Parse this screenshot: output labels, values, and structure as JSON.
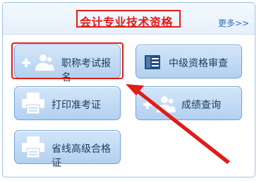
{
  "header": {
    "title": "会计专业技术资格",
    "more_label": "更多>>"
  },
  "tiles": [
    {
      "label": "职称考试报名",
      "icon": "add-user-icon"
    },
    {
      "label": "中级资格审查",
      "icon": "book-icon"
    },
    {
      "label": "打印准考证",
      "icon": "printer-icon"
    },
    {
      "label": "成绩查询",
      "icon": "add-user-icon"
    },
    {
      "label": "省线高级合格证",
      "icon": "printer-icon"
    }
  ],
  "colors": {
    "title": "#e01a1a",
    "annotation": "#e21b1b",
    "tile_border": "#6fa6d9",
    "tile_text": "#1d3b5c",
    "link": "#2f6fbf"
  }
}
